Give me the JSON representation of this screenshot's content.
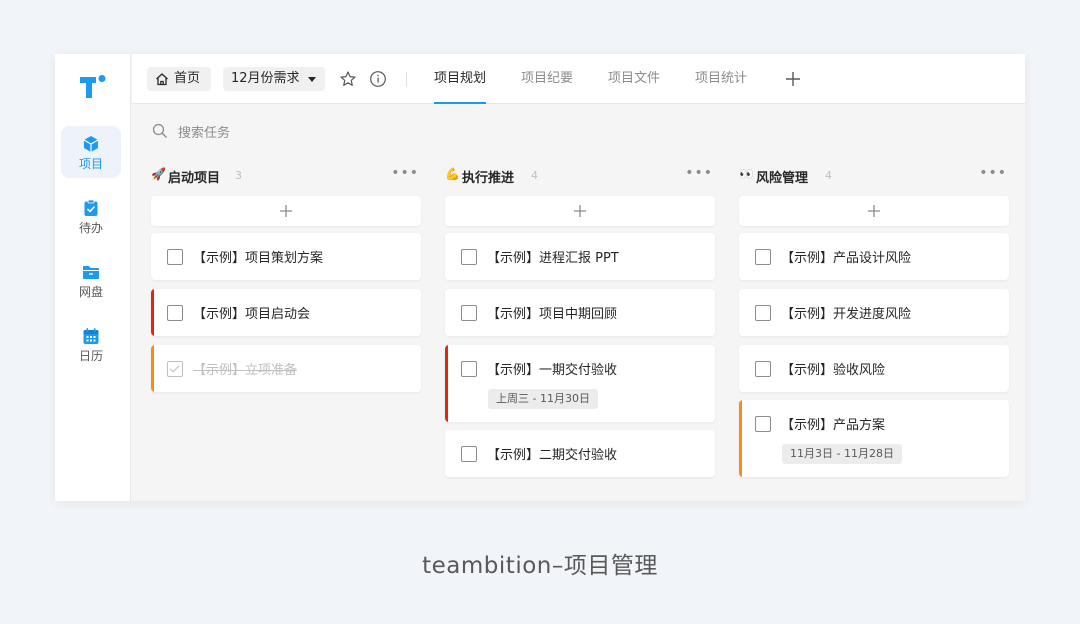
{
  "rail": {
    "items": [
      {
        "label": "项目",
        "icon": "cube-icon",
        "active": true
      },
      {
        "label": "待办",
        "icon": "clipboard-check-icon",
        "active": false
      },
      {
        "label": "网盘",
        "icon": "folder-icon",
        "active": false
      },
      {
        "label": "日历",
        "icon": "calendar-icon",
        "active": false
      }
    ]
  },
  "topbar": {
    "home_label": "首页",
    "project_name": "12月份需求",
    "tabs": [
      {
        "label": "项目规划",
        "active": true
      },
      {
        "label": "项目纪要",
        "active": false
      },
      {
        "label": "项目文件",
        "active": false
      },
      {
        "label": "项目统计",
        "active": false
      }
    ]
  },
  "search": {
    "placeholder": "搜索任务"
  },
  "columns": [
    {
      "emoji": "🚀",
      "title": "启动项目",
      "count": "3",
      "cards": [
        {
          "text": "【示例】项目策划方案",
          "done": false
        },
        {
          "text": "【示例】项目启动会",
          "done": false,
          "priority_color": "#e62412"
        },
        {
          "text": "【示例】立项准备",
          "done": true,
          "priority_color": "#fa8c15"
        }
      ]
    },
    {
      "emoji": "💪",
      "title": "执行推进",
      "count": "4",
      "cards": [
        {
          "text": "【示例】进程汇报 PPT",
          "done": false
        },
        {
          "text": "【示例】项目中期回顾",
          "done": false
        },
        {
          "text": "【示例】一期交付验收",
          "done": false,
          "priority_color": "#e62412",
          "date": "上周三 - 11月30日"
        },
        {
          "text": "【示例】二期交付验收",
          "done": false
        }
      ]
    },
    {
      "emoji": "👀",
      "title": "风险管理",
      "count": "4",
      "cards": [
        {
          "text": "【示例】产品设计风险",
          "done": false
        },
        {
          "text": "【示例】开发进度风险",
          "done": false
        },
        {
          "text": "【示例】验收风险",
          "done": false
        },
        {
          "text": "【示例】产品方案",
          "done": false,
          "priority_color": "#fa8c15",
          "date": "11月3日 - 11月28日"
        }
      ]
    }
  ],
  "caption": "teambition–项目管理",
  "colors": {
    "accent": "#1b9aee",
    "red": "#e62412",
    "orange": "#fa8c15"
  }
}
